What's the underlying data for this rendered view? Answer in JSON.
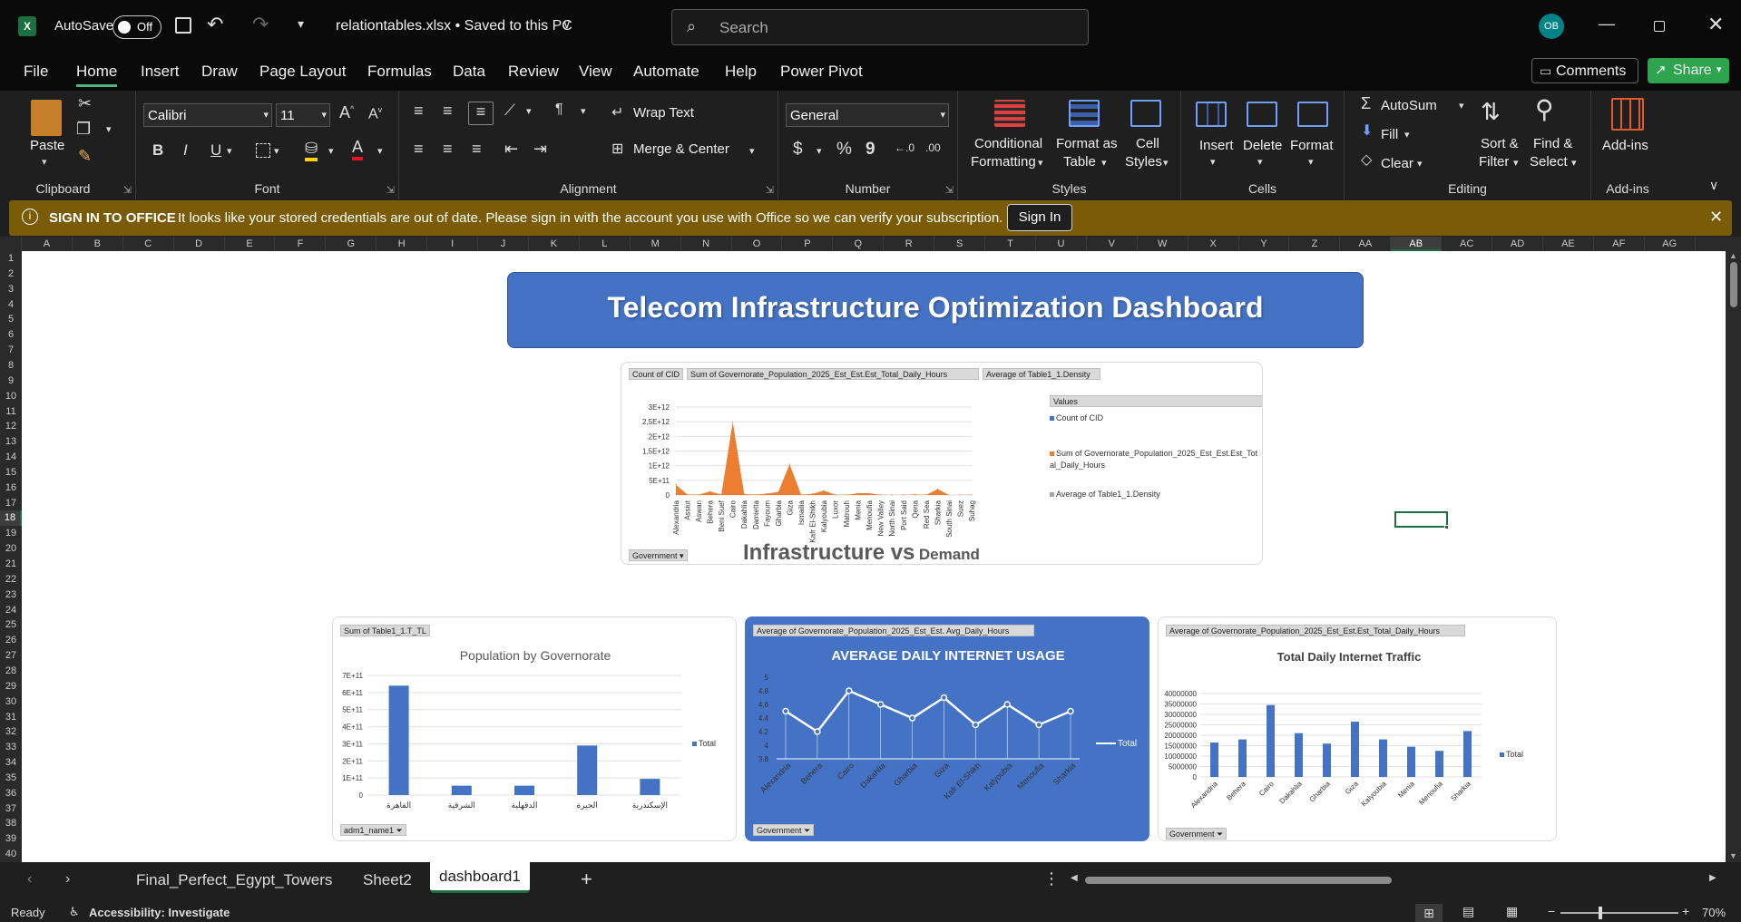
{
  "titlebar": {
    "autosave_label": "AutoSave",
    "autosave_state": "Off",
    "filename": "relationtables.xlsx • Saved to this PC",
    "search_placeholder": "Search",
    "avatar_initials": "OB"
  },
  "menu": {
    "items": [
      "File",
      "Home",
      "Insert",
      "Draw",
      "Page Layout",
      "Formulas",
      "Data",
      "Review",
      "View",
      "Automate",
      "Help",
      "Power Pivot"
    ],
    "active": "Home",
    "comments_label": "Comments",
    "share_label": "Share"
  },
  "ribbon": {
    "clipboard": {
      "paste": "Paste",
      "label": "Clipboard"
    },
    "font": {
      "name": "Calibri",
      "size": "11",
      "label": "Font",
      "bold": "B",
      "italic": "I",
      "underline": "U"
    },
    "alignment": {
      "wrap": "Wrap Text",
      "merge": "Merge & Center",
      "label": "Alignment"
    },
    "number": {
      "format": "General",
      "label": "Number",
      "currency": "$",
      "percent": "%",
      "comma": "9"
    },
    "styles": {
      "conditional_1": "Conditional",
      "conditional_2": "Formatting",
      "format_table_1": "Format as",
      "format_table_2": "Table",
      "cell_styles_1": "Cell",
      "cell_styles_2": "Styles",
      "label": "Styles"
    },
    "cells": {
      "insert": "Insert",
      "delete": "Delete",
      "format": "Format",
      "label": "Cells"
    },
    "editing": {
      "autosum": "AutoSum",
      "fill": "Fill",
      "clear": "Clear",
      "sort_1": "Sort &",
      "sort_2": "Filter",
      "find_1": "Find &",
      "find_2": "Select",
      "label": "Editing"
    },
    "addins": {
      "addins": "Add-ins",
      "label": "Add-ins"
    }
  },
  "infobar": {
    "title": "SIGN IN TO OFFICE",
    "message": "It looks like your stored credentials are out of date. Please sign in with the account you use with Office so we can verify your subscription.",
    "button": "Sign In"
  },
  "columns": [
    "A",
    "B",
    "C",
    "D",
    "E",
    "F",
    "G",
    "H",
    "I",
    "J",
    "K",
    "L",
    "M",
    "N",
    "O",
    "P",
    "Q",
    "R",
    "S",
    "T",
    "U",
    "V",
    "W",
    "X",
    "Y",
    "Z",
    "AA",
    "AB",
    "AC",
    "AD",
    "AE",
    "AF",
    "AG"
  ],
  "active_column": "AB",
  "active_row": "18",
  "rows": [
    "1",
    "2",
    "3",
    "4",
    "5",
    "6",
    "7",
    "8",
    "9",
    "10",
    "11",
    "12",
    "13",
    "14",
    "15",
    "16",
    "17",
    "18",
    "19",
    "20",
    "21",
    "22",
    "23",
    "24",
    "25",
    "26",
    "27",
    "28",
    "29",
    "30",
    "31",
    "32",
    "33",
    "34",
    "35",
    "36",
    "37",
    "38",
    "39",
    "40"
  ],
  "dashboard": {
    "title": "Telecom Infrastructure Optimization Dashboard",
    "main_chart": {
      "field_buttons": [
        "Count of CID",
        "Sum of Governorate_Population_2025_Est_Est.Est_Total_Daily_Hours",
        "Average of Table1_1.Density"
      ],
      "legend_header": "Values",
      "legend": [
        "Count of CID",
        "Sum of Governorate_Population_2025_Est_Est.Est_Total_Daily_Hours",
        "Average of Table1_1.Density"
      ],
      "axis_button": "Government",
      "caption_big": "Infrastructure vs",
      "caption_small": "Demand"
    },
    "pop_chart": {
      "field_button": "Sum of Table1_1.T_TL",
      "title": "Population by Governorate",
      "legend": "Total",
      "axis_button": "adm1_name1"
    },
    "usage_chart": {
      "field_button": "Average of Governorate_Population_2025_Est_Est. Avg_Daily_Hours",
      "title": "AVERAGE DAILY INTERNET USAGE",
      "legend": "Total",
      "axis_button": "Government"
    },
    "traffic_chart": {
      "field_button": "Average of Governorate_Population_2025_Est_Est.Est_Total_Daily_Hours",
      "title": "Total Daily Internet Traffic",
      "legend": "Total",
      "axis_button": "Government"
    }
  },
  "chart_data": [
    {
      "type": "area",
      "categories": [
        "Alexandria",
        "Assiut",
        "Aswan",
        "Behera",
        "Beni Suef",
        "Cairo",
        "Dakahlia",
        "Damietta",
        "Fayoum",
        "Gharbia",
        "Giza",
        "Ismailia",
        "Kafr El-Shikh",
        "Kalyoubia",
        "Luxor",
        "Matrouh",
        "Menia",
        "Menoufia",
        "New Valley",
        "North Sinai",
        "Port Said",
        "Qena",
        "Red Sea",
        "Sharkia",
        "South Sinai",
        "Suez",
        "Suhag"
      ],
      "series": [
        {
          "name": "Sum of Governorate_Population_2025_Est_Est.Est_Total_Daily_Hours",
          "values": [
            350000000000.0,
            20000000000.0,
            10000000000.0,
            120000000000.0,
            20000000000.0,
            2500000000000.0,
            30000000000.0,
            10000000000.0,
            50000000000.0,
            100000000000.0,
            1050000000000.0,
            10000000000.0,
            40000000000.0,
            150000000000.0,
            10000000000.0,
            5000000000.0,
            60000000000.0,
            60000000000.0,
            2000000000.0,
            5000000000.0,
            5000000000.0,
            20000000000.0,
            3000000000.0,
            200000000000.0,
            1000000000.0,
            5000000000.0,
            10000000000.0
          ]
        }
      ],
      "yticks": [
        "0",
        "5E+11",
        "1E+12",
        "1,5E+12",
        "2E+12",
        "2,5E+12",
        "3E+12"
      ],
      "ylim": [
        0,
        3000000000000.0
      ]
    },
    {
      "type": "bar",
      "title": "Population by Governorate",
      "categories": [
        "القاهرة",
        "الشرقية",
        "الدقهلية",
        "الجيزة",
        "الإسكندرية"
      ],
      "series": [
        {
          "name": "Total",
          "values": [
            640000000000.0,
            55000000000.0,
            55000000000.0,
            290000000000.0,
            95000000000.0
          ]
        }
      ],
      "yticks": [
        "0",
        "1E+11",
        "2E+11",
        "3E+11",
        "4E+11",
        "5E+11",
        "6E+11",
        "7E+11"
      ],
      "ylim": [
        0,
        700000000000.0
      ]
    },
    {
      "type": "line",
      "title": "AVERAGE DAILY INTERNET USAGE",
      "categories": [
        "Alexandria",
        "Behera",
        "Cairo",
        "Dakahlia",
        "Gharbia",
        "Giza",
        "Kafr El-Shikh",
        "Kalyoubia",
        "Menoufia",
        "Sharkia"
      ],
      "series": [
        {
          "name": "Total",
          "values": [
            4.5,
            4.2,
            4.8,
            4.6,
            4.4,
            4.7,
            4.3,
            4.6,
            4.3,
            4.5
          ]
        }
      ],
      "yticks": [
        "3.8",
        "4",
        "4.2",
        "4.4",
        "4.6",
        "4.8",
        "5"
      ],
      "ylim": [
        3.8,
        5
      ]
    },
    {
      "type": "bar",
      "title": "Total Daily Internet Traffic",
      "categories": [
        "Alexandria",
        "Behera",
        "Cairo",
        "Dakahlia",
        "Gharbia",
        "Giza",
        "Kalyoubia",
        "Menia",
        "Menoufia",
        "Sharkia"
      ],
      "series": [
        {
          "name": "Total",
          "values": [
            16500000,
            18000000,
            34500000,
            21000000,
            16000000,
            26500000,
            18000000,
            14500000,
            12500000,
            22000000
          ]
        }
      ],
      "yticks": [
        "0",
        "5000000",
        "10000000",
        "15000000",
        "20000000",
        "25000000",
        "30000000",
        "35000000",
        "40000000"
      ],
      "ylim": [
        0,
        40000000
      ]
    }
  ],
  "tabs": {
    "items": [
      "Final_Perfect_Egypt_Towers",
      "Sheet2",
      "dashboard1"
    ],
    "active": "dashboard1"
  },
  "status": {
    "ready": "Ready",
    "accessibility": "Accessibility: Investigate",
    "zoom": "70%"
  },
  "colors": {
    "accent": "#4472c4",
    "orange": "#ed7d31",
    "excel_green": "#1d6f42",
    "share_green": "#2ea44f"
  }
}
